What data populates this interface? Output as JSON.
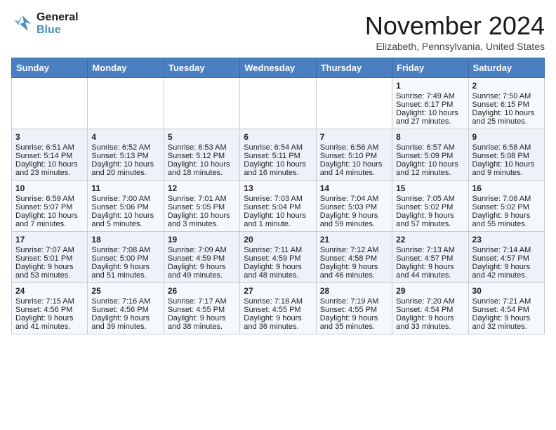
{
  "logo": {
    "line1": "General",
    "line2": "Blue"
  },
  "title": "November 2024",
  "location": "Elizabeth, Pennsylvania, United States",
  "weekdays": [
    "Sunday",
    "Monday",
    "Tuesday",
    "Wednesday",
    "Thursday",
    "Friday",
    "Saturday"
  ],
  "weeks": [
    [
      {
        "day": "",
        "content": ""
      },
      {
        "day": "",
        "content": ""
      },
      {
        "day": "",
        "content": ""
      },
      {
        "day": "",
        "content": ""
      },
      {
        "day": "",
        "content": ""
      },
      {
        "day": "1",
        "content": "Sunrise: 7:49 AM\nSunset: 6:17 PM\nDaylight: 10 hours and 27 minutes."
      },
      {
        "day": "2",
        "content": "Sunrise: 7:50 AM\nSunset: 6:15 PM\nDaylight: 10 hours and 25 minutes."
      }
    ],
    [
      {
        "day": "3",
        "content": "Sunrise: 6:51 AM\nSunset: 5:14 PM\nDaylight: 10 hours and 23 minutes."
      },
      {
        "day": "4",
        "content": "Sunrise: 6:52 AM\nSunset: 5:13 PM\nDaylight: 10 hours and 20 minutes."
      },
      {
        "day": "5",
        "content": "Sunrise: 6:53 AM\nSunset: 5:12 PM\nDaylight: 10 hours and 18 minutes."
      },
      {
        "day": "6",
        "content": "Sunrise: 6:54 AM\nSunset: 5:11 PM\nDaylight: 10 hours and 16 minutes."
      },
      {
        "day": "7",
        "content": "Sunrise: 6:56 AM\nSunset: 5:10 PM\nDaylight: 10 hours and 14 minutes."
      },
      {
        "day": "8",
        "content": "Sunrise: 6:57 AM\nSunset: 5:09 PM\nDaylight: 10 hours and 12 minutes."
      },
      {
        "day": "9",
        "content": "Sunrise: 6:58 AM\nSunset: 5:08 PM\nDaylight: 10 hours and 9 minutes."
      }
    ],
    [
      {
        "day": "10",
        "content": "Sunrise: 6:59 AM\nSunset: 5:07 PM\nDaylight: 10 hours and 7 minutes."
      },
      {
        "day": "11",
        "content": "Sunrise: 7:00 AM\nSunset: 5:06 PM\nDaylight: 10 hours and 5 minutes."
      },
      {
        "day": "12",
        "content": "Sunrise: 7:01 AM\nSunset: 5:05 PM\nDaylight: 10 hours and 3 minutes."
      },
      {
        "day": "13",
        "content": "Sunrise: 7:03 AM\nSunset: 5:04 PM\nDaylight: 10 hours and 1 minute."
      },
      {
        "day": "14",
        "content": "Sunrise: 7:04 AM\nSunset: 5:03 PM\nDaylight: 9 hours and 59 minutes."
      },
      {
        "day": "15",
        "content": "Sunrise: 7:05 AM\nSunset: 5:02 PM\nDaylight: 9 hours and 57 minutes."
      },
      {
        "day": "16",
        "content": "Sunrise: 7:06 AM\nSunset: 5:02 PM\nDaylight: 9 hours and 55 minutes."
      }
    ],
    [
      {
        "day": "17",
        "content": "Sunrise: 7:07 AM\nSunset: 5:01 PM\nDaylight: 9 hours and 53 minutes."
      },
      {
        "day": "18",
        "content": "Sunrise: 7:08 AM\nSunset: 5:00 PM\nDaylight: 9 hours and 51 minutes."
      },
      {
        "day": "19",
        "content": "Sunrise: 7:09 AM\nSunset: 4:59 PM\nDaylight: 9 hours and 49 minutes."
      },
      {
        "day": "20",
        "content": "Sunrise: 7:11 AM\nSunset: 4:59 PM\nDaylight: 9 hours and 48 minutes."
      },
      {
        "day": "21",
        "content": "Sunrise: 7:12 AM\nSunset: 4:58 PM\nDaylight: 9 hours and 46 minutes."
      },
      {
        "day": "22",
        "content": "Sunrise: 7:13 AM\nSunset: 4:57 PM\nDaylight: 9 hours and 44 minutes."
      },
      {
        "day": "23",
        "content": "Sunrise: 7:14 AM\nSunset: 4:57 PM\nDaylight: 9 hours and 42 minutes."
      }
    ],
    [
      {
        "day": "24",
        "content": "Sunrise: 7:15 AM\nSunset: 4:56 PM\nDaylight: 9 hours and 41 minutes."
      },
      {
        "day": "25",
        "content": "Sunrise: 7:16 AM\nSunset: 4:56 PM\nDaylight: 9 hours and 39 minutes."
      },
      {
        "day": "26",
        "content": "Sunrise: 7:17 AM\nSunset: 4:55 PM\nDaylight: 9 hours and 38 minutes."
      },
      {
        "day": "27",
        "content": "Sunrise: 7:18 AM\nSunset: 4:55 PM\nDaylight: 9 hours and 36 minutes."
      },
      {
        "day": "28",
        "content": "Sunrise: 7:19 AM\nSunset: 4:55 PM\nDaylight: 9 hours and 35 minutes."
      },
      {
        "day": "29",
        "content": "Sunrise: 7:20 AM\nSunset: 4:54 PM\nDaylight: 9 hours and 33 minutes."
      },
      {
        "day": "30",
        "content": "Sunrise: 7:21 AM\nSunset: 4:54 PM\nDaylight: 9 hours and 32 minutes."
      }
    ]
  ]
}
